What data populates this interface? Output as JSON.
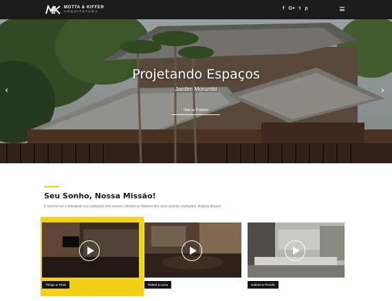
{
  "brand": {
    "name_line1": "MOTTA & KIFFER",
    "name_line2": "ARQUITETURA"
  },
  "social": [
    {
      "icon": "facebook-icon",
      "label": "f"
    },
    {
      "icon": "google-plus-icon",
      "label": "G+"
    },
    {
      "icon": "twitter-icon",
      "label": "t"
    },
    {
      "icon": "pinterest-icon",
      "label": "p"
    }
  ],
  "hero": {
    "title": "Projetando Espaços",
    "subtitle": "Jardim Morumbi",
    "button_label": "Veja os Projetos",
    "prev_label": "‹",
    "next_label": "›"
  },
  "mission": {
    "title": "Seu Sonho, Nossa Missão!",
    "description": "É incrível ver a felicidade e a realização dos nossos clientes ao falarem dos seus sonhos realizados. Assista abaixo!"
  },
  "videos": [
    {
      "label": "Thiago & Thais"
    },
    {
      "label": "Rafael & Luiza"
    },
    {
      "label": "Gabriel & Priscila"
    }
  ],
  "colors": {
    "accent": "#f2d119",
    "topbar": "#1b1b1b",
    "label_bg": "#141414"
  }
}
